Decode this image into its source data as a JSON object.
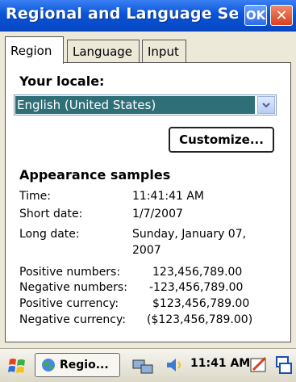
{
  "window": {
    "title": "Regional and Language Se...",
    "ok_label": "OK",
    "close_symbol": "✕"
  },
  "tabs": [
    {
      "label": "Region",
      "active": true
    },
    {
      "label": "Language",
      "active": false
    },
    {
      "label": "Input",
      "active": false
    }
  ],
  "locale": {
    "heading": "Your locale:",
    "selected": "English (United States)",
    "customize_label": "Customize..."
  },
  "samples": {
    "heading": "Appearance samples",
    "time_label": "Time:",
    "time_value": "11:41:41 AM",
    "short_date_label": "Short date:",
    "short_date_value": "1/7/2007",
    "long_date_label": "Long date:",
    "long_date_value_line1": "Sunday, January 07,",
    "long_date_value_line2": "2007",
    "positive_numbers_label": "Positive numbers:",
    "positive_numbers_value": "123,456,789.00",
    "negative_numbers_label": "Negative numbers:",
    "negative_numbers_value": "-123,456,789.00",
    "positive_currency_label": "Positive currency:",
    "positive_currency_value": "$123,456,789.00",
    "negative_currency_label": "Negative currency:",
    "negative_currency_value": "($123,456,789.00)"
  },
  "taskbar": {
    "task_label": "Regio...",
    "clock": "11:41 AM",
    "icons": [
      "start-flag-icon",
      "regional-settings-icon",
      "network-icon",
      "volume-icon",
      "input-panel-icon",
      "window-switcher-icon"
    ]
  },
  "colors": {
    "title_bar": "#0a55d8",
    "selection": "#2f6f78",
    "close_button": "#d8401e"
  }
}
